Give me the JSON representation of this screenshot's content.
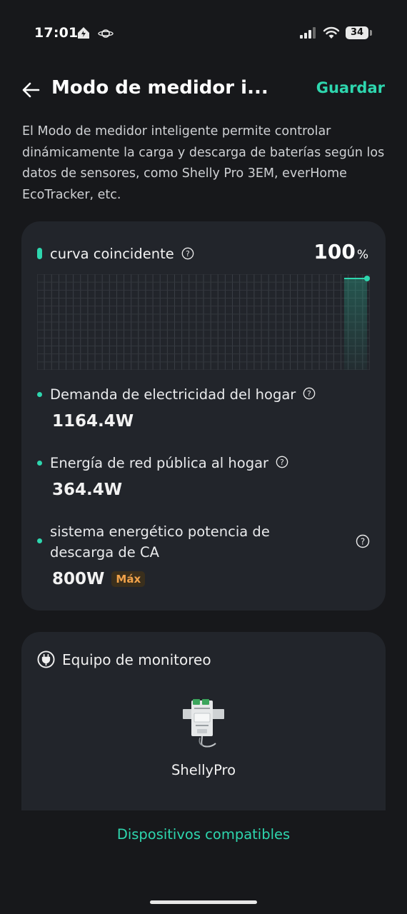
{
  "status_bar": {
    "time": "17:01",
    "battery_level": "34"
  },
  "header": {
    "title": "Modo de medidor i...",
    "save_label": "Guardar"
  },
  "description": "El Modo de medidor inteligente permite controlar dinámicamente la carga y descarga de baterías según los datos de sensores, como Shelly Pro 3EM, everHome EcoTracker, etc.",
  "curve_card": {
    "title": "curva coincidente",
    "percent_value": "100",
    "percent_unit": "%",
    "match_fraction": 1.0,
    "metrics": [
      {
        "label": "Demanda de electricidad del hogar",
        "value": "1164.4W"
      },
      {
        "label": "Energía de red pública al hogar",
        "value": "364.4W"
      },
      {
        "label": "sistema energético potencia de descarga de CA",
        "value": "800W",
        "badge": "Máx"
      }
    ]
  },
  "monitor_card": {
    "title": "Equipo de monitoreo",
    "device_name": "ShellyPro"
  },
  "compatible_devices_label": "Dispositivos compatibles",
  "colors": {
    "accent": "#2ed6ae",
    "background": "#17181b",
    "card": "#22252b",
    "badge_text": "#f0a24a"
  },
  "icons": [
    "home-icon",
    "orbit-icon",
    "signal-icon",
    "wifi-icon",
    "battery-icon",
    "back-arrow-icon",
    "help-icon",
    "plug-icon"
  ]
}
